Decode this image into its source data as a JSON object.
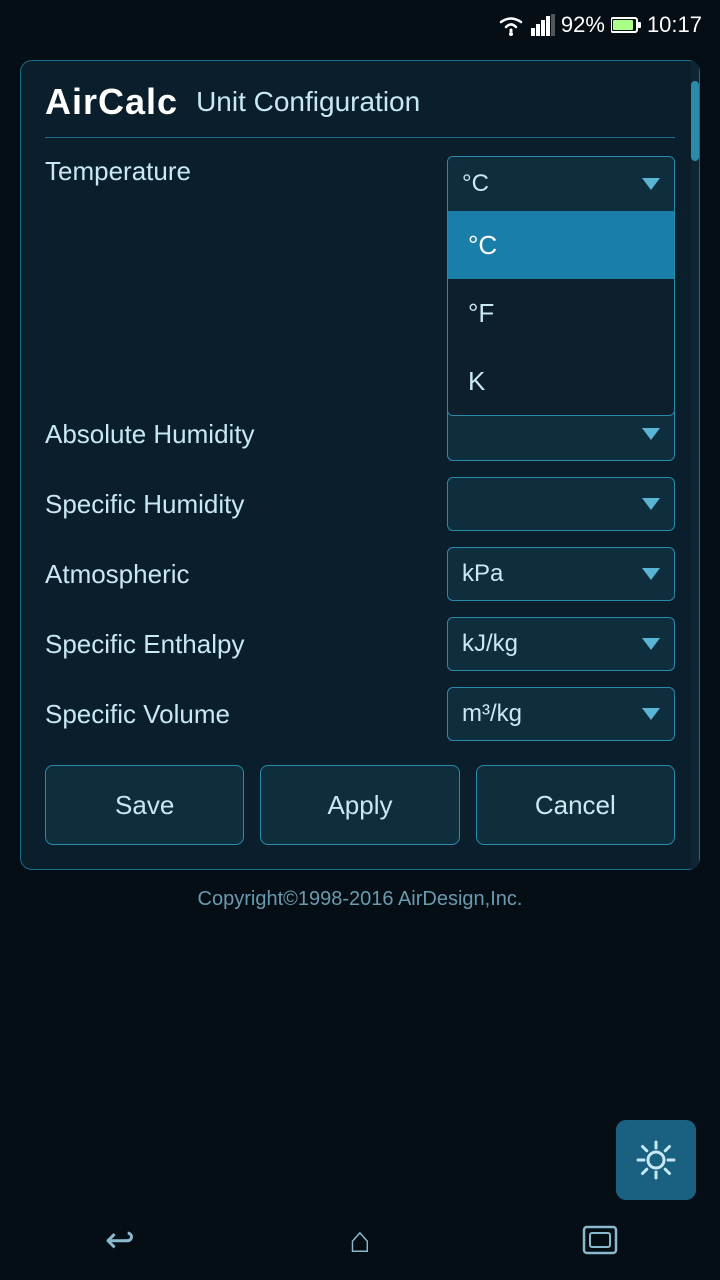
{
  "statusBar": {
    "wifi": "wifi",
    "signal": "signal",
    "battery": "92%",
    "time": "10:17"
  },
  "header": {
    "appTitle": "AirCalc",
    "pageTitle": "Unit Configuration"
  },
  "fields": [
    {
      "id": "temperature",
      "label": "Temperature",
      "value": "°C",
      "isOpen": true,
      "options": [
        "°C",
        "°F",
        "K"
      ]
    },
    {
      "id": "absoluteHumidity",
      "label": "Absolute Humidity",
      "value": "",
      "isOpen": false,
      "options": []
    },
    {
      "id": "specificHumidity",
      "label": "Specific Humidity",
      "value": "",
      "isOpen": false,
      "options": []
    },
    {
      "id": "atmospheric",
      "label": "Atmospheric",
      "value": "kPa",
      "isOpen": false,
      "options": []
    },
    {
      "id": "specificEnthalpy",
      "label": "Specific Enthalpy",
      "value": "kJ/kg",
      "isOpen": false,
      "options": []
    },
    {
      "id": "specificVolume",
      "label": "Specific Volume",
      "value": "m³/kg",
      "isOpen": false,
      "options": []
    }
  ],
  "buttons": {
    "save": "Save",
    "apply": "Apply",
    "cancel": "Cancel"
  },
  "copyright": "Copyright©1998-2016 AirDesign,Inc.",
  "dropdown": {
    "selectedOption": "°C",
    "options": [
      "°C",
      "°F",
      "K"
    ]
  },
  "nav": {
    "back": "back",
    "home": "home",
    "recents": "recents"
  }
}
